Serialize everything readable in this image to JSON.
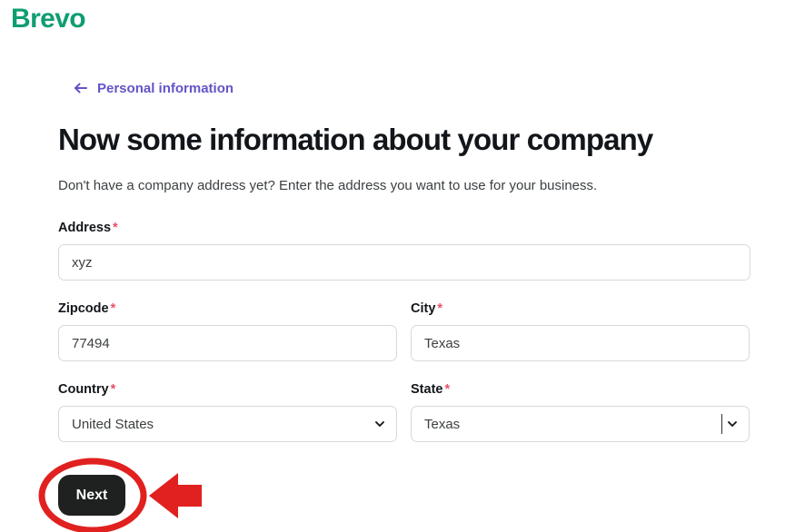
{
  "brand": {
    "name": "Brevo",
    "color": "#0f9d72"
  },
  "back_link": {
    "label": "Personal information",
    "icon": "arrow-left-icon",
    "color": "#6254c9"
  },
  "heading": {
    "title": "Now some information about your company",
    "subtitle": "Don't have a company address yet? Enter the address you want to use for your business."
  },
  "form": {
    "required_marker": "*",
    "fields": {
      "address": {
        "label": "Address",
        "value": "xyz",
        "placeholder": ""
      },
      "zipcode": {
        "label": "Zipcode",
        "value": "77494",
        "placeholder": ""
      },
      "city": {
        "label": "City",
        "value": "Texas",
        "placeholder": ""
      },
      "country": {
        "label": "Country",
        "value": "United States",
        "icon": "chevron-down-icon"
      },
      "state": {
        "label": "State",
        "value": "Texas",
        "icon": "chevron-down-icon"
      }
    }
  },
  "actions": {
    "next_label": "Next"
  },
  "annotation": {
    "ellipse_color": "#e0211f",
    "arrow_color": "#e0211f",
    "ellipse_name": "red-ellipse-highlight",
    "arrow_name": "red-arrow-pointer"
  },
  "colors": {
    "accent_green": "#0f9d72",
    "link_purple": "#6254c9",
    "required_red": "#e8506a",
    "button_dark": "#1f2121",
    "input_border": "#d6d9dd",
    "annotation_red": "#e0211f"
  }
}
